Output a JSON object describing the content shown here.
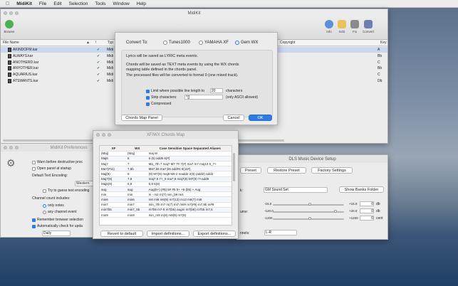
{
  "menubar": {
    "app": "MidiKit",
    "items": [
      "File",
      "Edit",
      "Selection",
      "Tools",
      "Window",
      "Help"
    ]
  },
  "main": {
    "title": "MidiKit",
    "toolbar": {
      "browse": "Browse",
      "info": "Info",
      "edit": "Edit",
      "fix": "Fix",
      "convert": "Convert"
    },
    "columns": {
      "file": "File Name",
      "type": "Typ",
      "copyright": "Copyright",
      "key": "Key"
    },
    "files": [
      {
        "name": "AKINDOFM.kar",
        "type": "Midi",
        "key": "A"
      },
      {
        "name": "ALWAYS.kar",
        "type": "Midi",
        "key": "Bb"
      },
      {
        "name": "ANOTHERD.kar",
        "type": "Midi",
        "key": "C"
      },
      {
        "name": "ANYOTHER.kar",
        "type": "Midi",
        "key": "Bb"
      },
      {
        "name": "AQUARIUS.kar",
        "type": "Midi",
        "key": "C"
      },
      {
        "name": "ATSWANTS.kar",
        "type": "Midi",
        "key": "Db"
      }
    ]
  },
  "sheet": {
    "convert_to": "Convert To:",
    "options": [
      "Tunes1000",
      "YAMAHA XF",
      "Gem WX"
    ],
    "selected": "Gem WX",
    "line1": "Lyrics will be saved as LYRIC meta events.",
    "line2a": "Chords will be saved as TEXT meta events by using the WX chords",
    "line2b": "mapping table defined in the chords panel.",
    "line3": "The processed files will be converted to format 0 (one mixed track).",
    "limit_label": "Limit where possible line length to",
    "limit_value": "20",
    "limit_unit": "characters",
    "strip_label": "Strip characters:",
    "strip_value": "^[]",
    "strip_note": "(only ASCII allowed)",
    "compressed": "Compressed",
    "chords_map": "Chords Map Panel",
    "cancel": "Cancel",
    "ok": "OK"
  },
  "chords": {
    "title": "XF/WX Chords Map",
    "headers": [
      "XF",
      "WX",
      "Case Sensitive Space Separated Aliases"
    ],
    "rows": [
      [
        "(Maj)",
        "(Maj)",
        "maj M"
      ],
      [
        "Maj6",
        "6",
        "6 (6) add6 6(#)"
      ],
      [
        "Maj7",
        "7",
        "Ma_7th 7 maj7 M7 7# 7(#) ma7 m7 maj13 6_7+"
      ],
      [
        "Ma7(#11)",
        "7,5b",
        "Ma7,b5 ma7,b5 add#4 6(11#)"
      ],
      [
        "Maj(9)",
        "9",
        "(9) M7(9) maj9 M9 2 madd2 2(9) (add2) add2"
      ],
      [
        "Maj7(9)",
        "7,9",
        "maj7,9 7+_9 ma7,9 maj7(9) M7(9) 7+add9"
      ],
      [
        "Maj6(9)",
        "6,9",
        "6,9 6(9)"
      ],
      [
        "aug",
        "aug",
        "Aug(5+) (#5) 5# #5 5+ +5 (b5) + Aug"
      ],
      [
        "min",
        "min",
        "m - m2 m(7) min_b9 mi4"
      ],
      [
        "min6",
        "min6",
        "m6 mi6 m6(9) m7(13) m13 m6(7) mi6"
      ],
      [
        "min7",
        "min7",
        "min_7th m7 m(7) mi7 m6# m7(#9) m7,9b m#9"
      ],
      [
        "min7b5",
        "min7_5b",
        "m7b5 m7-5 m7(b5) augm m7(b9) m7b5 m7,5"
      ],
      [
        "min9",
        "min9",
        "min_m9 m(9) m9(9) m7(9)"
      ]
    ],
    "revert": "Revert to default",
    "import": "Import definitions...",
    "export": "Export definitions..."
  },
  "pref": {
    "title": "MidiKit Preferences",
    "warn": "Warn before destructive proc",
    "open_startup": "Open panel at startup",
    "encoding_label": "Default Text Encoding:",
    "encoding_value": "Western",
    "guess": "Try to guess text encoding",
    "channel_label": "Channel count includes:",
    "only_notes": "only notes",
    "any_event": "any channel event",
    "remember": "Remember browser selection",
    "auto_check": "Automatically check for upda",
    "frequency": "Daily"
  },
  "dls": {
    "title": "DLS Music Device Setup",
    "preset": "Preset",
    "restore": "Restore Preset",
    "factory": "Factory Settings",
    "bank_label": "k:",
    "bank_value": "GM Sound Set",
    "show_banks": "Show Banks Folder",
    "volume_label": "ume:",
    "channels_label": "nnels:",
    "channels_value": "L-R",
    "rows": [
      {
        "min": "-15.0",
        "max": "+15.0",
        "val": "0",
        "unit": "db"
      },
      {
        "min": "-120.0",
        "max": "+20.0",
        "val": "0",
        "unit": "db"
      },
      {
        "min": "-1200",
        "max": "+1200",
        "val": "0",
        "unit": "cent"
      }
    ]
  }
}
